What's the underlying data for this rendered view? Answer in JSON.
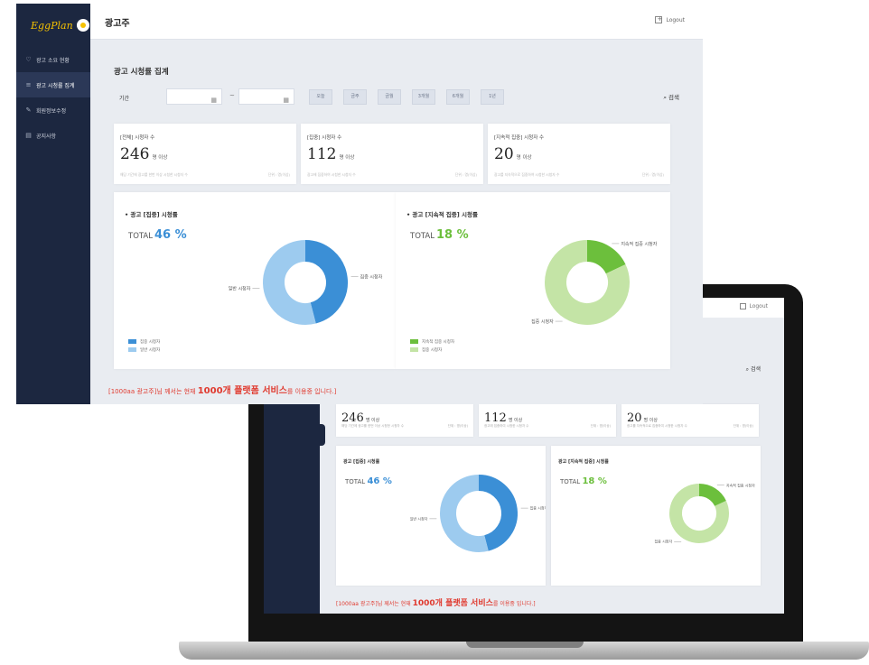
{
  "app": {
    "logo_text": "EggPlan",
    "page_title": "광고주",
    "logout_label": "Logout"
  },
  "sidebar": {
    "items": [
      {
        "label": "광고 소요 현황",
        "icon": "heart-icon"
      },
      {
        "label": "광고 시청률 집계",
        "icon": "list-icon"
      },
      {
        "label": "회원정보수정",
        "icon": "edit-icon"
      },
      {
        "label": "공지사항",
        "icon": "notice-icon"
      }
    ]
  },
  "filter": {
    "section_title": "광고 시청률 집계",
    "label": "기간",
    "date_separator": "~",
    "buttons": [
      "오늘",
      "금주",
      "금월",
      "3개월",
      "6개월",
      "1년"
    ],
    "search_label": "검색"
  },
  "stats": [
    {
      "label": "[전체] 시청자 수",
      "value": "246",
      "unit": "명 이상",
      "desc": "해당 기간에 광고를 한번 이상 시청한 시청자 수",
      "note": "단위 : 명(이상)"
    },
    {
      "label": "[집중] 시청자 수",
      "value": "112",
      "unit": "명 이상",
      "desc": "광고에 집중하여 시청한 시청자 수",
      "note": "단위 : 명(이상)"
    },
    {
      "label": "[지속적 집중] 시청자 수",
      "value": "20",
      "unit": "명 이상",
      "desc": "광고를 지속적으로 집중하여 시청한 시청자 수",
      "note": "단위 : 명(이상)"
    }
  ],
  "chart_data": [
    {
      "type": "pie",
      "title": "광고 [집중] 시청률",
      "total_label": "TOTAL",
      "total_value": "46 %",
      "accent": "#3b8fd6",
      "categories": [
        "집중 시청자",
        "일반 시청자"
      ],
      "values": [
        46,
        54
      ],
      "colors": [
        "#3b8fd6",
        "#9dcbef"
      ],
      "callouts": [
        "집중 시청자",
        "일반 시청자"
      ]
    },
    {
      "type": "pie",
      "title": "광고 [지속적 집중] 시청률",
      "total_label": "TOTAL",
      "total_value": "18 %",
      "accent": "#6cbf3c",
      "categories": [
        "지속적 집중 시청자",
        "집중 시청자"
      ],
      "values": [
        18,
        82
      ],
      "colors": [
        "#6cbf3c",
        "#c4e4a6"
      ],
      "callouts": [
        "지속적 집중 시청자",
        "집중 시청자"
      ]
    }
  ],
  "banner": {
    "prefix": "[1000aa 광고주]님 께서는 현재 ",
    "highlight": "1000개 플랫폼 서비스",
    "suffix": "를 이용중 입니다.]"
  }
}
